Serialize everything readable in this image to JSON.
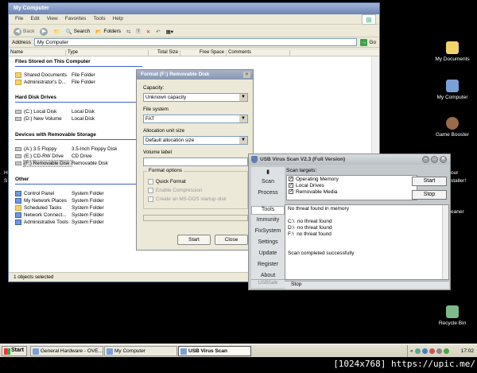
{
  "my_computer": {
    "title": "My Computer",
    "menu": [
      "File",
      "Edit",
      "View",
      "Favorites",
      "Tools",
      "Help"
    ],
    "toolbar": {
      "back": "Back",
      "search": "Search",
      "folders": "Folders"
    },
    "address": {
      "label": "Address",
      "value": "My Computer",
      "go": "Go"
    },
    "columns": [
      "Name",
      "Type",
      "Total Size",
      "Free Space",
      "Comments"
    ],
    "groups": {
      "files": "Files Stored on This Computer",
      "drives": "Hard Disk Drives",
      "removable": "Devices with Removable Storage",
      "other": "Other"
    },
    "files": [
      {
        "name": "Shared Documents",
        "type": "File Folder"
      },
      {
        "name": "Administrator's D...",
        "type": "File Folder"
      }
    ],
    "drives": [
      {
        "name": "(C:) Local Disk",
        "type": "Local Disk"
      },
      {
        "name": "(D:) New Volume",
        "type": "Local Disk"
      }
    ],
    "removable": [
      {
        "name": "(A:) 3.5 Floppy",
        "type": "3.5-Inch Floppy Disk"
      },
      {
        "name": "(E:) CD-RW Drive",
        "type": "CD Drive"
      },
      {
        "name": "(F:) Removable Disk",
        "type": "Removable Disk"
      }
    ],
    "other": [
      {
        "name": "Control Panel",
        "type": "System Folder"
      },
      {
        "name": "My Network Places",
        "type": "System Folder"
      },
      {
        "name": "Scheduled Tasks",
        "type": "System Folder"
      },
      {
        "name": "Network Connect...",
        "type": "System Folder"
      },
      {
        "name": "Administrative Tools",
        "type": "System Folder"
      }
    ],
    "status": "1 objects selected"
  },
  "format_dialog": {
    "title": "Format (F:) Removable Disk",
    "capacity_label": "Capacity:",
    "capacity_value": "Unknown capacity",
    "fs_label": "File system",
    "fs_value": "FAT",
    "alloc_label": "Allocation unit size",
    "alloc_value": "Default allocation size",
    "volume_label": "Volume label",
    "volume_value": "",
    "options_title": "Format options",
    "opt_quick": "Quick Format",
    "opt_compress": "Enable Compression",
    "opt_startup": "Create an MS-DOS startup disk",
    "start": "Start",
    "close": "Close"
  },
  "usb_scan": {
    "title": "USB Virus Scan V2.3 (Full Version)",
    "nav": [
      "Scan",
      "Process",
      "Tools",
      "Immunity",
      "FixSystem",
      "Settings",
      "Update",
      "Register",
      "About"
    ],
    "active_nav": "Tools",
    "logo_text": "USBSafe",
    "targets_label": "Scan targets:",
    "targets": [
      {
        "label": "Operating Memory",
        "checked": true
      },
      {
        "label": "Local Drives",
        "checked": true
      },
      {
        "label": "Removable Media",
        "checked": true
      }
    ],
    "start": "Start",
    "stop": "Stop",
    "log": [
      "No threat found in memory",
      "",
      "C:\\  no threat found",
      "D:\\  no threat found",
      "F:\\  no threat found",
      "",
      "",
      "Scan completed successfully"
    ],
    "stop_tab": "Stop"
  },
  "desktop_icons": [
    "My Documents",
    "My Computer",
    "Game Booster",
    "Recycle Bin"
  ],
  "desktop_partial": {
    "left_h": "H",
    "left_s": "S",
    "right_your": "our",
    "right_installer": "staller!",
    "right_cleaner": "eaner"
  },
  "taskbar": {
    "start": "Start",
    "tasks": [
      "General Hardware - OVE...",
      "My Computer",
      "USB Virus Scan"
    ],
    "clock": "17:02"
  },
  "watermark": "[1024x768] https://upic.me/"
}
